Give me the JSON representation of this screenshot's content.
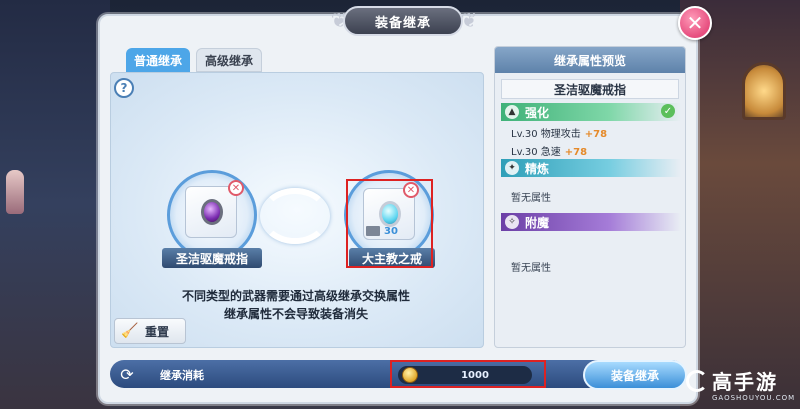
{
  "window": {
    "title": "装备继承"
  },
  "tabs": [
    {
      "label": "普通继承",
      "active": true
    },
    {
      "label": "高级继承",
      "active": false
    }
  ],
  "slots": {
    "source": {
      "name": "圣洁驱魔戒指"
    },
    "target": {
      "name": "大主教之戒",
      "level": "30"
    }
  },
  "info": {
    "line1": "不同类型的武器需要通过高级继承交换属性",
    "line2": "继承属性不会导致装备消失"
  },
  "reset_label": "重置",
  "attr_panel": {
    "title": "继承属性预览",
    "item_name": "圣洁驱魔戒指",
    "sections": {
      "strengthen": {
        "label": "强化"
      },
      "refine": {
        "label": "精炼"
      },
      "enchant": {
        "label": "附魔"
      }
    },
    "stats": [
      {
        "text": "Lv.30 物理攻击",
        "bonus": "+78"
      },
      {
        "text": "Lv.30 急速",
        "bonus": "+78"
      }
    ],
    "refine_none": "暂无属性",
    "enchant_none": "暂无属性"
  },
  "bottom": {
    "cost_label": "继承消耗",
    "cost_value": "1000",
    "inherit_button": "装备继承"
  },
  "watermark": {
    "text": "高手游",
    "sub": "GAOSHOUYOU.COM"
  },
  "colors": {
    "accent": "#4da6e8",
    "highlight": "#dd2222",
    "bonus": "#e58a2a"
  }
}
